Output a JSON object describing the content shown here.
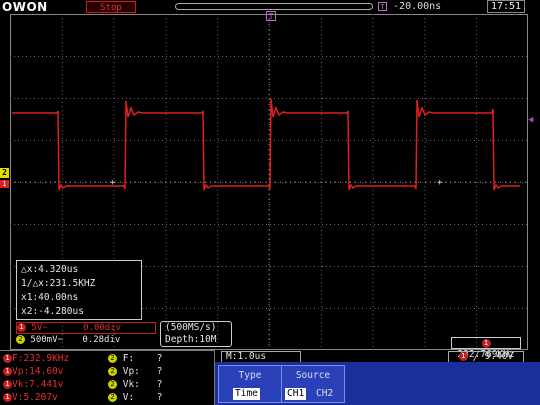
{
  "brand": "OWON",
  "status": "Stop",
  "trigger_time": "-20.00ns",
  "trigger_time_marker": "T",
  "clock": "17:51",
  "channels": {
    "ch1_marker": "1",
    "ch2_marker": "2",
    "trigger_level_marker": "◀",
    "trace_color": "#e02020"
  },
  "cursor": {
    "delta_x": "△x:4.320us",
    "inv_delta_x": "1/△x:231.5KHZ",
    "x1": "x1:40.00ns",
    "x2": "x2:-4.280us"
  },
  "ch1_info": {
    "badge": "1",
    "volts": "5V~",
    "offset": "0.00div"
  },
  "ch2_info": {
    "badge": "2",
    "volts": "500mV~",
    "offset": "0.28div"
  },
  "acquisition": {
    "sample_rate": "(500MS/s)",
    "depth": "Depth:10M"
  },
  "frequency": {
    "badge": "1",
    "value": "232.769KHz"
  },
  "measurements": {
    "ch1": [
      {
        "badge": "1",
        "text": "F:232.9KHz"
      },
      {
        "badge": "1",
        "text": "Vp:14.60v"
      },
      {
        "badge": "1",
        "text": "Vk:7.441v"
      },
      {
        "badge": "1",
        "text": "V:5.207v"
      }
    ],
    "ch2": [
      {
        "badge": "2",
        "label": "F:",
        "value": "?"
      },
      {
        "badge": "2",
        "label": "Vp:",
        "value": "?"
      },
      {
        "badge": "2",
        "label": "Vk:",
        "value": "?"
      },
      {
        "badge": "2",
        "label": "V:",
        "value": "?"
      }
    ]
  },
  "timebase": "M:1.0us",
  "trigger": {
    "badge": "1",
    "edge_icon": "rising-edge",
    "value": "9.40V"
  },
  "menu": {
    "type": {
      "title": "Type",
      "option": "Time"
    },
    "source": {
      "title": "Source",
      "options": [
        "CH1",
        "CH2"
      ],
      "selected": "CH1"
    }
  }
}
